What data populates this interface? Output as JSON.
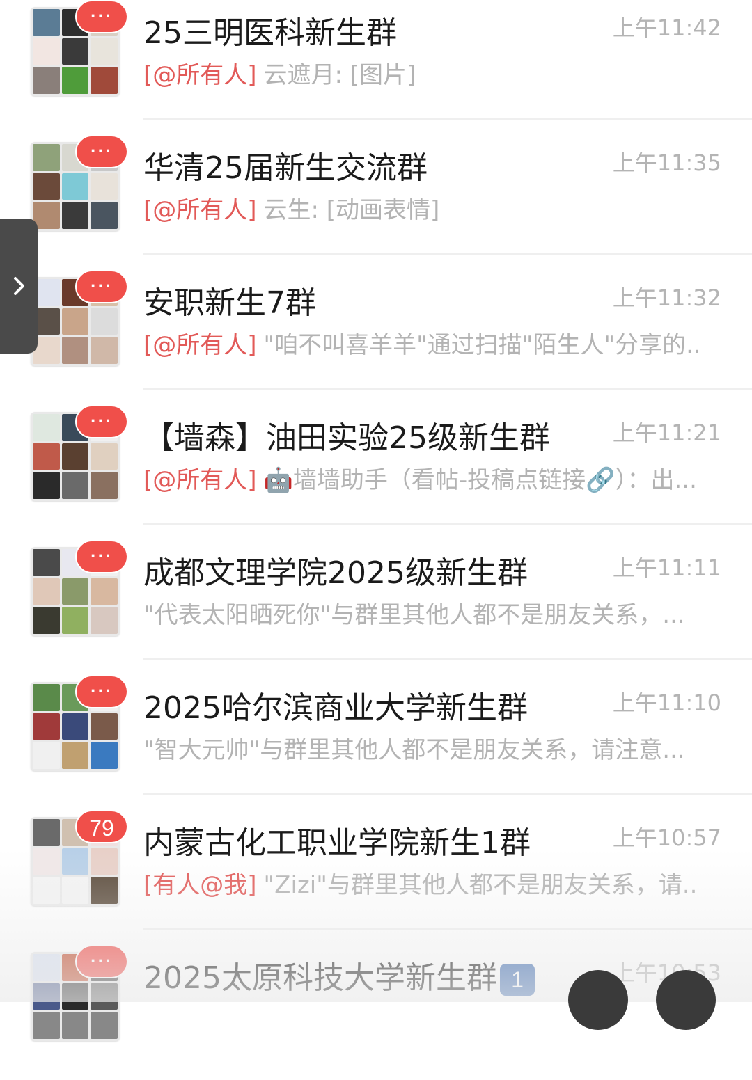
{
  "chats": [
    {
      "title": "25三明医科新生群",
      "time": "上午11:42",
      "mention": "[@所有人]",
      "preview": "云遮月: [图片]",
      "badge": "···"
    },
    {
      "title": "华清25届新生交流群",
      "time": "上午11:35",
      "mention": "[@所有人]",
      "preview": "云生: [动画表情]",
      "badge": "···"
    },
    {
      "title": "安职新生7群",
      "time": "上午11:32",
      "mention": "[@所有人]",
      "preview": "\"咱不叫喜羊羊\"通过扫描\"陌生人\"分享的...",
      "badge": "···"
    },
    {
      "title": "【墙森】油田实验25级新生群",
      "time": "上午11:21",
      "mention": "[@所有人]",
      "preview": "🤖墙墙助手（看帖-投稿点链接🔗）：出...",
      "badge": "···"
    },
    {
      "title": "成都文理学院2025级新生群",
      "time": "上午11:11",
      "mention": "",
      "preview": "\"代表太阳晒死你\"与群里其他人都不是朋友关系，...",
      "badge": "···"
    },
    {
      "title": "2025哈尔滨商业大学新生群",
      "time": "上午11:10",
      "mention": "",
      "preview": "\"智大元帅\"与群里其他人都不是朋友关系，请注意...",
      "badge": "···"
    },
    {
      "title": "内蒙古化工职业学院新生1群",
      "time": "上午10:57",
      "mention": "[有人@我]",
      "preview": "\"Zizi\"与群里其他人都不是朋友关系，请...",
      "badge": "79"
    },
    {
      "title": "2025太原科技大学新生群",
      "title_emoji": "1",
      "time": "上午10:53",
      "mention": "",
      "preview": "",
      "badge": "···"
    }
  ],
  "colors": {
    "mention": "#e25a58",
    "badge": "#f04f4a",
    "title": "#1b1b1b",
    "meta": "#b4b4b4"
  },
  "icons": {
    "side_handle": "chevron-right-icon"
  }
}
